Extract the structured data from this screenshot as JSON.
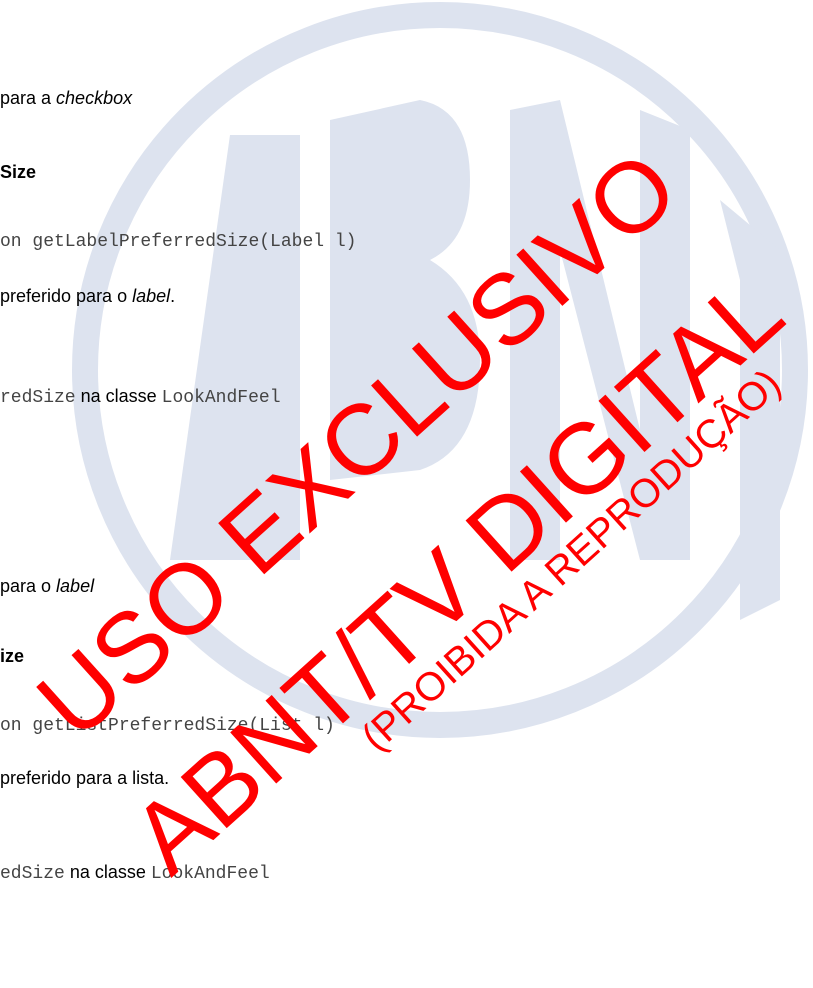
{
  "section1": {
    "desc_prefix": "para a ",
    "desc_em": "checkbox",
    "method_title": "Size",
    "signature": "on getLabelPreferredSize(Label l)",
    "return_prefix": "preferido para o ",
    "return_em": "label",
    "return_suffix": ".",
    "override_code": "redSize",
    "override_mid": " na classe ",
    "override_class": "LookAndFeel"
  },
  "section2": {
    "desc_prefix": "para o ",
    "desc_em": "label",
    "method_title": "ize",
    "signature": "on getListPreferredSize(List l)",
    "return_text": "preferido para a lista.",
    "override_code": "edSize",
    "override_mid": " na classe ",
    "override_class": "LookAndFeel"
  },
  "watermark": {
    "logo_letters": "ABNT",
    "line1": "USO EXCLUSIVO",
    "line2": "ABNT/TV DIGITAL",
    "line3": "(PROIBIDA A REPRODUÇÃO)",
    "logo_color": "#dde3ef",
    "stamp_color": "#ff0000"
  }
}
